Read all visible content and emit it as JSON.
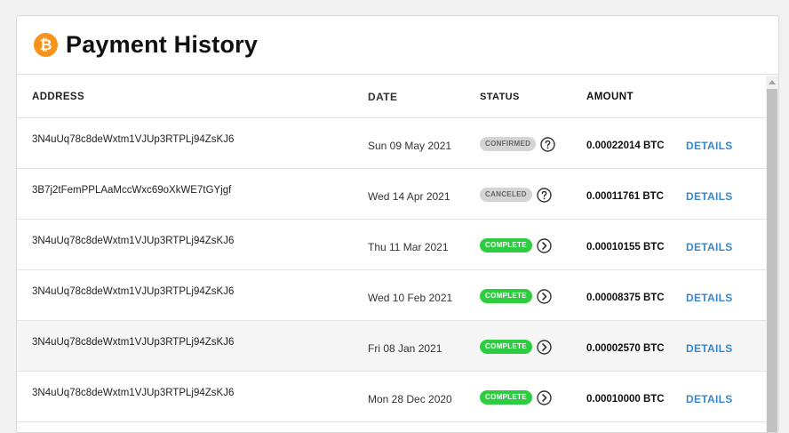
{
  "header": {
    "title": "Payment History",
    "icon": "bitcoin-icon",
    "icon_glyph": "₿"
  },
  "columns": {
    "address": "ADDRESS",
    "date": "DATE",
    "status": "STATUS",
    "amount": "AMOUNT"
  },
  "colors": {
    "accent_btc": "#f7931a",
    "complete": "#2ecc40",
    "neutral_badge": "#d4d4d4",
    "link": "#3a86c8"
  },
  "rows": [
    {
      "address": "3N4uUq78c8deWxtm1VJUp3RTPLj94ZsKJ6",
      "date": "Sun 09 May 2021",
      "status": "CONFIRMED",
      "status_kind": "grey",
      "status_icon": "question-icon",
      "amount": "0.00022014 BTC",
      "details": "DETAILS"
    },
    {
      "address": "3B7j2tFemPPLAaMccWxc69oXkWE7tGYjgf",
      "date": "Wed 14 Apr 2021",
      "status": "CANCELED",
      "status_kind": "grey",
      "status_icon": "question-icon",
      "amount": "0.00011761 BTC",
      "details": "DETAILS"
    },
    {
      "address": "3N4uUq78c8deWxtm1VJUp3RTPLj94ZsKJ6",
      "date": "Thu 11 Mar 2021",
      "status": "COMPLETE",
      "status_kind": "green",
      "status_icon": "chevron-right-icon",
      "amount": "0.00010155 BTC",
      "details": "DETAILS"
    },
    {
      "address": "3N4uUq78c8deWxtm1VJUp3RTPLj94ZsKJ6",
      "date": "Wed 10 Feb 2021",
      "status": "COMPLETE",
      "status_kind": "green",
      "status_icon": "chevron-right-icon",
      "amount": "0.00008375 BTC",
      "details": "DETAILS"
    },
    {
      "address": "3N4uUq78c8deWxtm1VJUp3RTPLj94ZsKJ6",
      "date": "Fri 08 Jan 2021",
      "status": "COMPLETE",
      "status_kind": "green",
      "status_icon": "chevron-right-icon",
      "amount": "0.00002570 BTC",
      "details": "DETAILS"
    },
    {
      "address": "3N4uUq78c8deWxtm1VJUp3RTPLj94ZsKJ6",
      "date": "Mon 28 Dec 2020",
      "status": "COMPLETE",
      "status_kind": "green",
      "status_icon": "chevron-right-icon",
      "amount": "0.00010000 BTC",
      "details": "DETAILS"
    }
  ]
}
